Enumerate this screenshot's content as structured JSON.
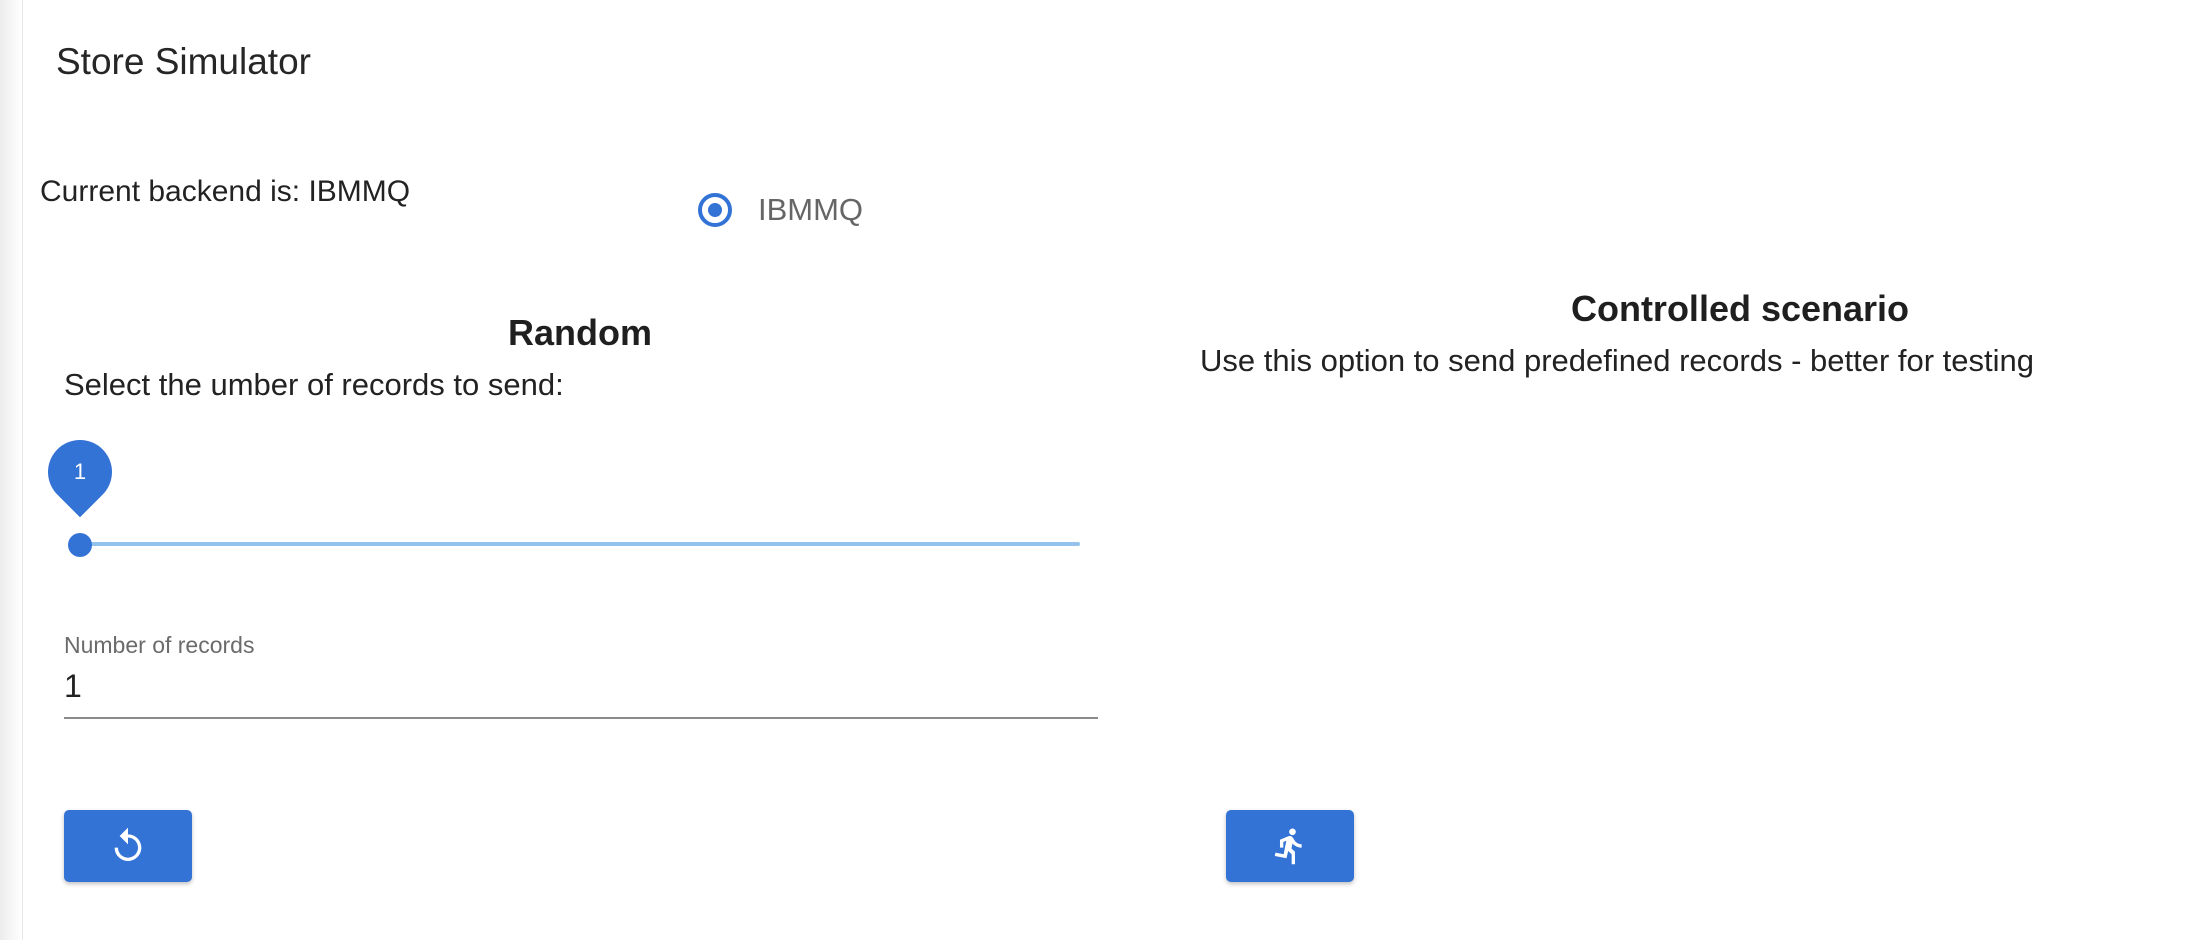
{
  "app": {
    "title": "Store Simulator"
  },
  "backend": {
    "status_text": "Current backend is: IBMMQ",
    "options": [
      {
        "label": "IBMMQ",
        "selected": true
      }
    ]
  },
  "random": {
    "title": "Random",
    "description": "Select the umber of records to send:",
    "slider_value": "1",
    "field_label": "Number of records",
    "field_value": "1",
    "reset_button_icon": "reset-icon"
  },
  "controlled": {
    "title": "Controlled scenario",
    "description": "Use this option to send predefined records - better for testing",
    "run_button_icon": "run-icon"
  },
  "colors": {
    "accent": "#3373d6",
    "slider_rail": "#93c3ec"
  }
}
